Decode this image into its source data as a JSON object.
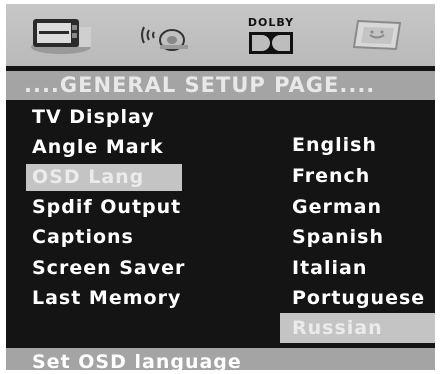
{
  "icon_bar": {
    "icons": [
      "general-setup-tv-icon",
      "audio-speaker-icon",
      "dolby-icon",
      "preference-icon"
    ],
    "dolby_label": "DOLBY"
  },
  "page_title": "....GENERAL SETUP PAGE....",
  "menu": {
    "items": [
      {
        "label": "TV Display"
      },
      {
        "label": "Angle Mark"
      },
      {
        "label": "OSD Lang"
      },
      {
        "label": "Spdif Output"
      },
      {
        "label": "Captions"
      },
      {
        "label": "Screen Saver"
      },
      {
        "label": "Last Memory"
      }
    ],
    "selected": "OSD Lang"
  },
  "options": {
    "items": [
      {
        "label": "English"
      },
      {
        "label": "French"
      },
      {
        "label": "German"
      },
      {
        "label": "Spanish"
      },
      {
        "label": "Italian"
      },
      {
        "label": "Portuguese"
      },
      {
        "label": "Russian"
      }
    ],
    "selected": "Russian"
  },
  "status": "Set OSD language",
  "colors": {
    "background": "#141414",
    "bar": "#a4a4a4",
    "highlight": "#c4c4c4",
    "text": "#ffffff"
  }
}
